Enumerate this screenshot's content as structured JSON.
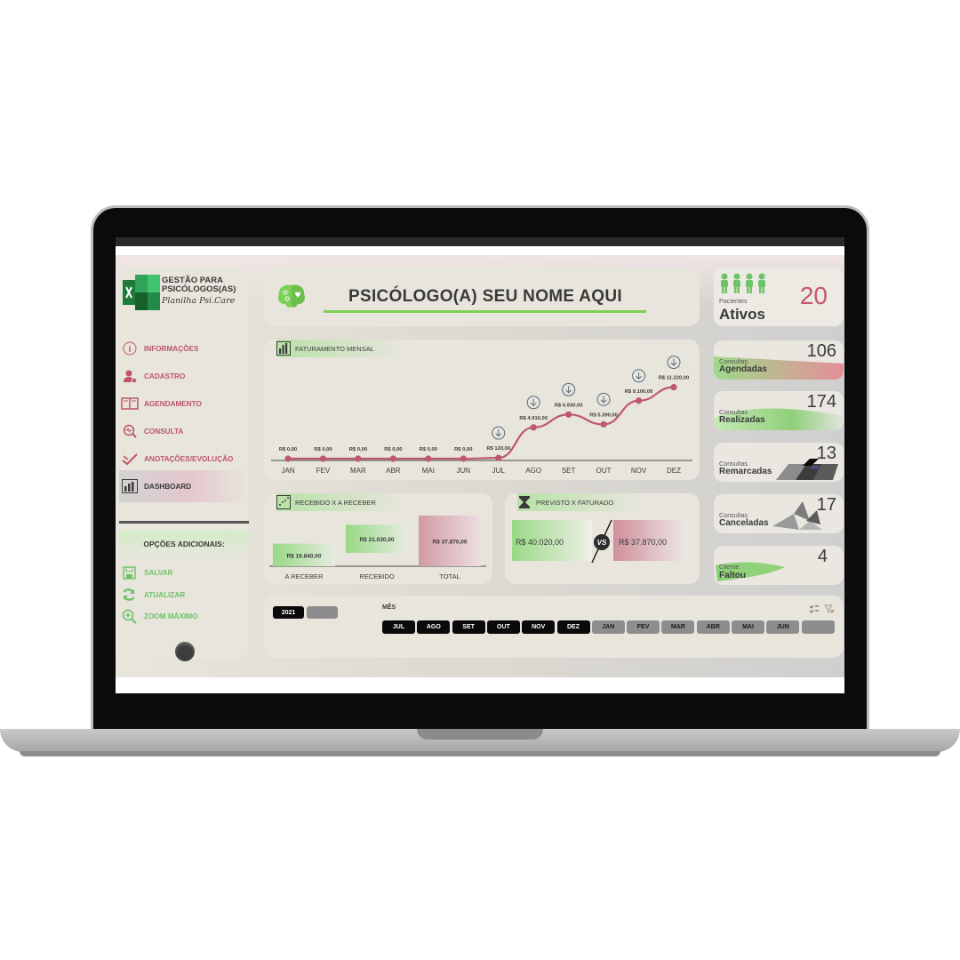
{
  "app": {
    "logo_title_line1": "GESTÃO PARA",
    "logo_title_line2": "PSICÓLOGOS(AS)",
    "logo_subtitle": "Planilha Psi.Care",
    "header_title": "PSICÓLOGO(A) SEU NOME AQUI"
  },
  "sidebar": {
    "items": [
      {
        "label": "INFORMAÇÕES",
        "icon": "info-icon"
      },
      {
        "label": "CADASTRO",
        "icon": "add-user-icon"
      },
      {
        "label": "AGENDAMENTO",
        "icon": "book-icon"
      },
      {
        "label": "CONSULTA",
        "icon": "search-pulse-icon"
      },
      {
        "label": "ANOTAÇÕES/EVOLUÇÃO",
        "icon": "pen-icon"
      },
      {
        "label": "DASHBOARD",
        "icon": "bar-chart-icon"
      }
    ],
    "options_header": "OPÇÕES ADICIONAIS:",
    "options": [
      {
        "label": "SALVAR",
        "icon": "save-icon"
      },
      {
        "label": "ATUALIZAR",
        "icon": "refresh-icon"
      },
      {
        "label": "ZOOM MÁXIMO",
        "icon": "zoom-icon"
      }
    ]
  },
  "faturamento": {
    "title": "FATURAMENTO MENSAL"
  },
  "chart_data": {
    "type": "line",
    "title": "FATURAMENTO MENSAL",
    "categories": [
      "JAN",
      "FEV",
      "MAR",
      "ABR",
      "MAI",
      "JUN",
      "JUL",
      "AGO",
      "SET",
      "OUT",
      "NOV",
      "DEZ"
    ],
    "values": [
      0,
      0,
      0,
      0,
      0,
      0,
      120,
      4910,
      6930,
      5390,
      9100,
      11220
    ],
    "data_labels": [
      "R$ 0,00",
      "R$ 0,00",
      "R$ 0,00",
      "R$ 0,00",
      "R$ 0,00",
      "R$ 0,00",
      "R$ 120,00",
      "R$ 4.910,00",
      "R$ 6.930,00",
      "R$ 5.390,00",
      "R$ 9.100,00",
      "R$ 11.220,00"
    ],
    "marker_icon_from_index": 6,
    "ylim": [
      0,
      12000
    ],
    "color": "#c0576c",
    "grid": false
  },
  "recebido": {
    "title": "RECEBIDO X A RECEBER",
    "categories": [
      "A RECEBER",
      "RECEBIDO",
      "TOTAL"
    ],
    "values": [
      16840,
      21030,
      37870
    ],
    "labels": [
      "R$ 16.840,00",
      "R$ 21.030,00",
      "R$ 37.870,00"
    ]
  },
  "previsto": {
    "title": "PREVISTO X FATURADO",
    "previsto_value": "R$ 40.020,00",
    "vs": "VS",
    "faturado_value": "R$ 37.870,00"
  },
  "kpis": {
    "pacientes": {
      "small": "Pacientes",
      "big": "Ativos",
      "value": "20"
    },
    "agendadas": {
      "small": "Consultas",
      "big": "Agendadas",
      "value": "106"
    },
    "realizadas": {
      "small": "Consultas",
      "big": "Realizadas",
      "value": "174"
    },
    "remarcadas": {
      "small": "Consultas",
      "big": "Remarcadas",
      "value": "13"
    },
    "canceladas": {
      "small": "Consultas",
      "big": "Canceladas",
      "value": "17"
    },
    "faltou": {
      "small": "Cliente",
      "big": "Faltou",
      "value": "4"
    }
  },
  "filters": {
    "years": [
      "2021",
      ""
    ],
    "month_label": "MÊS",
    "months": [
      {
        "label": "JUL",
        "selected": true
      },
      {
        "label": "AGO",
        "selected": true
      },
      {
        "label": "SET",
        "selected": true
      },
      {
        "label": "OUT",
        "selected": true
      },
      {
        "label": "NOV",
        "selected": true
      },
      {
        "label": "DEZ",
        "selected": true
      },
      {
        "label": "JAN",
        "selected": false
      },
      {
        "label": "FEV",
        "selected": false
      },
      {
        "label": "MAR",
        "selected": false
      },
      {
        "label": "ABR",
        "selected": false
      },
      {
        "label": "MAI",
        "selected": false
      },
      {
        "label": "JUN",
        "selected": false
      },
      {
        "label": "",
        "selected": false
      }
    ]
  },
  "colors": {
    "accent_pink": "#c0546b",
    "accent_green": "#7dcf57",
    "panel": "#e7e5dc"
  }
}
